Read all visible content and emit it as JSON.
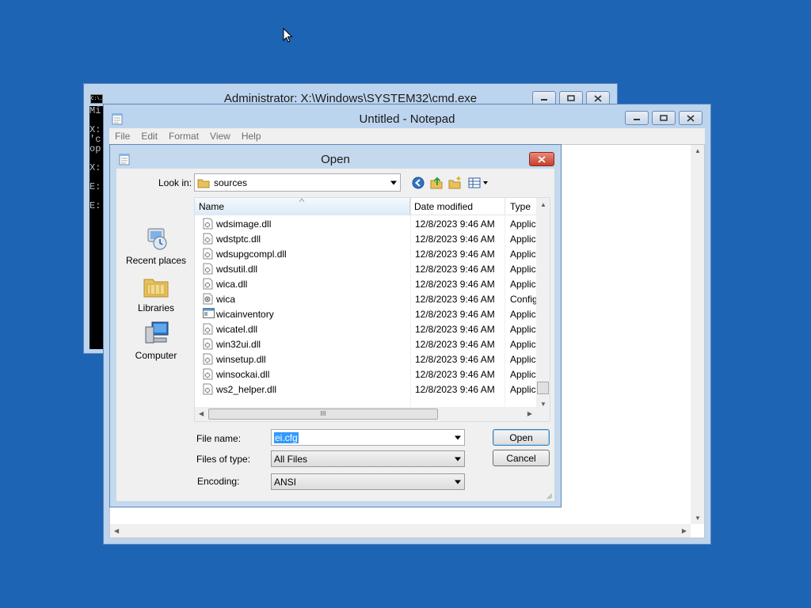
{
  "cmd": {
    "title": "Administrator: X:\\Windows\\SYSTEM32\\cmd.exe",
    "icon_text": "C:\\.",
    "lines": [
      "Mi",
      "",
      "X:",
      "'c",
      "op",
      "",
      "X:",
      "",
      "E:",
      "",
      "E:"
    ]
  },
  "notepad": {
    "title": "Untitled - Notepad",
    "menu": [
      "File",
      "Edit",
      "Format",
      "View",
      "Help"
    ]
  },
  "dialog": {
    "title": "Open",
    "look_in_label": "Look in:",
    "look_in_value": "sources",
    "places": [
      {
        "label": "Recent places",
        "icon": "recent-places-icon"
      },
      {
        "label": "Libraries",
        "icon": "libraries-icon"
      },
      {
        "label": "Computer",
        "icon": "computer-icon"
      }
    ],
    "columns": {
      "name": "Name",
      "date": "Date modified",
      "type": "Type"
    },
    "files": [
      {
        "name": "wdsimage.dll",
        "date": "12/8/2023 9:46 AM",
        "type": "Applic",
        "icon": "dll-file-icon"
      },
      {
        "name": "wdstptc.dll",
        "date": "12/8/2023 9:46 AM",
        "type": "Applic",
        "icon": "dll-file-icon"
      },
      {
        "name": "wdsupgcompl.dll",
        "date": "12/8/2023 9:46 AM",
        "type": "Applic",
        "icon": "dll-file-icon"
      },
      {
        "name": "wdsutil.dll",
        "date": "12/8/2023 9:46 AM",
        "type": "Applic",
        "icon": "dll-file-icon"
      },
      {
        "name": "wica.dll",
        "date": "12/8/2023 9:46 AM",
        "type": "Applic",
        "icon": "dll-file-icon"
      },
      {
        "name": "wica",
        "date": "12/8/2023 9:46 AM",
        "type": "Config",
        "icon": "config-file-icon"
      },
      {
        "name": "wicainventory",
        "date": "12/8/2023 9:46 AM",
        "type": "Applic",
        "icon": "exe-file-icon"
      },
      {
        "name": "wicatel.dll",
        "date": "12/8/2023 9:46 AM",
        "type": "Applic",
        "icon": "dll-file-icon"
      },
      {
        "name": "win32ui.dll",
        "date": "12/8/2023 9:46 AM",
        "type": "Applic",
        "icon": "dll-file-icon"
      },
      {
        "name": "winsetup.dll",
        "date": "12/8/2023 9:46 AM",
        "type": "Applic",
        "icon": "dll-file-icon"
      },
      {
        "name": "winsockai.dll",
        "date": "12/8/2023 9:46 AM",
        "type": "Applic",
        "icon": "dll-file-icon"
      },
      {
        "name": "ws2_helper.dll",
        "date": "12/8/2023 9:46 AM",
        "type": "Applic",
        "icon": "dll-file-icon"
      }
    ],
    "file_name_label": "File name:",
    "file_name_value": "ei.cfg",
    "files_of_type_label": "Files of type:",
    "files_of_type_value": "All Files",
    "encoding_label": "Encoding:",
    "encoding_value": "ANSI",
    "open_label": "Open",
    "cancel_label": "Cancel",
    "hscroll_grip": "III"
  },
  "colors": {
    "desktop": "#1e64b4",
    "selection": "#3399ff",
    "close": "#c5402a"
  }
}
